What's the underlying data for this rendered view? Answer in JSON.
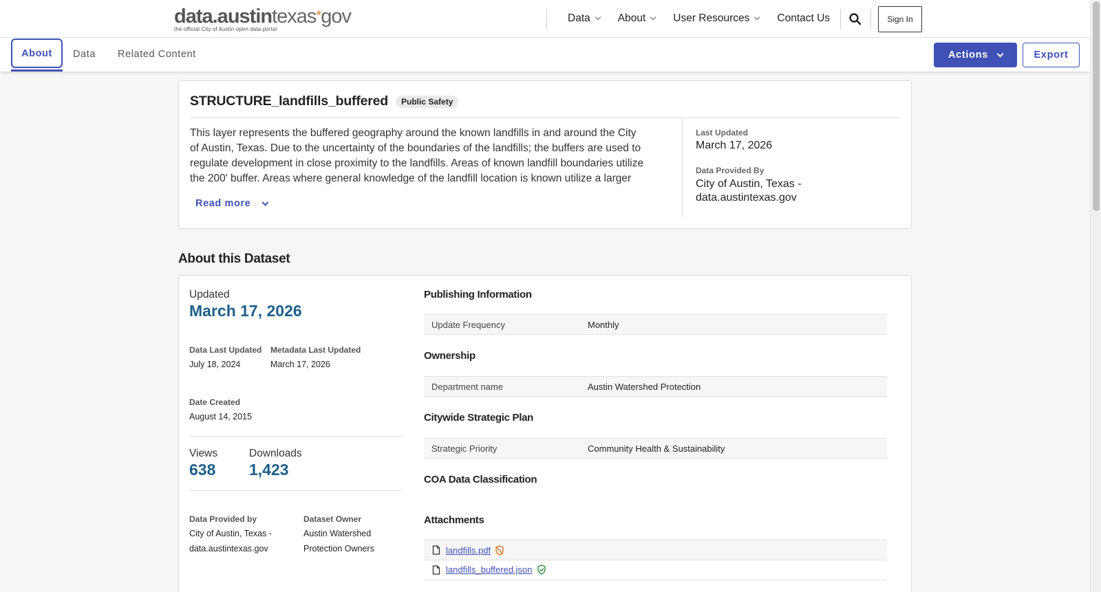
{
  "header": {
    "logo": {
      "main_bold": "data.austin",
      "main_thin": "texas",
      "star": "*",
      "suffix": "gov",
      "tagline": "the official City of Austin open data portal"
    },
    "nav": [
      {
        "label": "Data",
        "has_dropdown": true
      },
      {
        "label": "About",
        "has_dropdown": true
      },
      {
        "label": "User Resources",
        "has_dropdown": true
      },
      {
        "label": "Contact Us",
        "has_dropdown": false
      }
    ],
    "search_icon": "search-icon",
    "sign_in_label": "Sign In"
  },
  "tabs": {
    "active": "About",
    "items": [
      "About",
      "Data",
      "Related Content"
    ],
    "actions_label": "Actions",
    "export_label": "Export",
    "accent_color": "#3f51b5"
  },
  "summary": {
    "title": "STRUCTURE_landfills_buffered",
    "category_badge": "Public Safety",
    "description": "This layer represents the buffered geography around the known landfills in and around the City of Austin, Texas. Due to the uncertainty of the boundaries of the landfills; the buffers are used to regulate development in close proximity to the landfills. Areas of known landfill boundaries utilize the 200' buffer. Areas where general knowledge of the landfill location is known utilize a larger buffer.",
    "read_more_label": "Read more",
    "last_updated_label": "Last Updated",
    "last_updated": "March 17, 2026",
    "data_provided_by_label": "Data Provided By",
    "data_provided_by": "City of Austin, Texas - data.austintexas.gov"
  },
  "about": {
    "heading": "About this Dataset",
    "updated_label": "Updated",
    "updated": "March 17, 2026",
    "data_last_updated_label": "Data Last Updated",
    "data_last_updated": "July 18, 2024",
    "metadata_last_updated_label": "Metadata Last Updated",
    "metadata_last_updated": "March 17, 2026",
    "date_created_label": "Date Created",
    "date_created": "August 14, 2015",
    "views_label": "Views",
    "views": "638",
    "downloads_label": "Downloads",
    "downloads": "1,423",
    "provided_by_label": "Data Provided by",
    "provided_by": "City of Austin, Texas - data.austintexas.gov",
    "owner_label": "Dataset Owner",
    "owner": "Austin Watershed Protection Owners",
    "value_color": "#1e5f8a",
    "publishing": {
      "title": "Publishing Information",
      "rows": [
        {
          "key": "Update Frequency",
          "value": "Monthly"
        }
      ]
    },
    "ownership": {
      "title": "Ownership",
      "rows": [
        {
          "key": "Department name",
          "value": "Austin Watershed Protection"
        }
      ]
    },
    "strategic": {
      "title": "Citywide Strategic Plan",
      "rows": [
        {
          "key": "Strategic Priority",
          "value": "Community Health & Sustainability"
        }
      ]
    },
    "classification": {
      "title": "COA Data Classification"
    },
    "attachments": {
      "title": "Attachments",
      "files": [
        {
          "name": "landfills.pdf",
          "icon": "shield-off-icon",
          "icon_color": "#e07a2e"
        },
        {
          "name": "landfills_buffered.json",
          "icon": "shield-check-icon",
          "icon_color": "#2e8b3e"
        }
      ]
    }
  }
}
